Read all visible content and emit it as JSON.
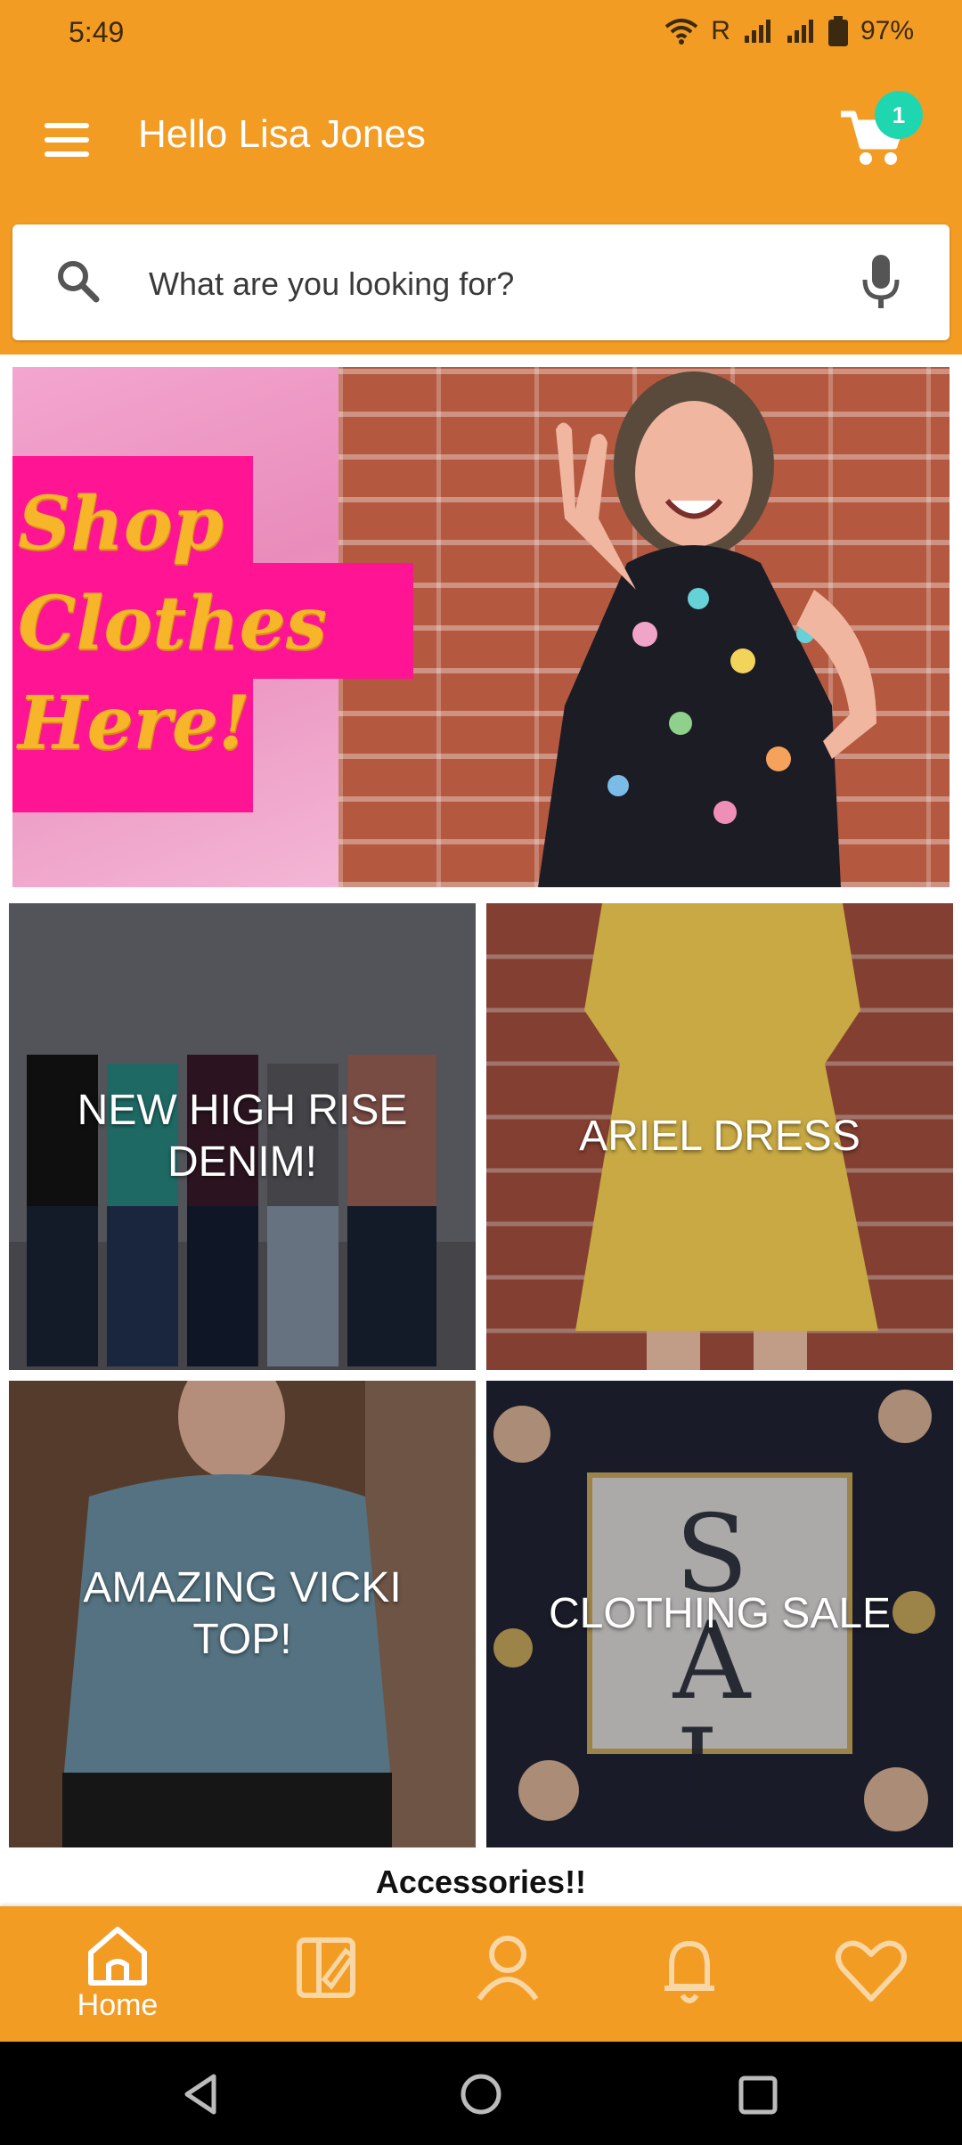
{
  "status_bar": {
    "time": "5:49",
    "network_label": "R",
    "battery": "97%"
  },
  "header": {
    "greeting": "Hello Lisa Jones",
    "cart_count": "1"
  },
  "search": {
    "placeholder": "What are you looking for?"
  },
  "hero": {
    "text": "Shop\nClothes\nHere!"
  },
  "tiles": [
    {
      "title": "NEW HIGH RISE DENIM!"
    },
    {
      "title": "ARIEL DRESS"
    },
    {
      "title": "AMAZING VICKI TOP!"
    },
    {
      "title": "CLOTHING SALE"
    }
  ],
  "sale_sign": {
    "letters": "SALE"
  },
  "section": {
    "title": "Accessories!!"
  },
  "bottom_nav": {
    "items": [
      {
        "label": "Home",
        "icon": "home-icon",
        "active": true
      },
      {
        "label": "",
        "icon": "catalog-icon"
      },
      {
        "label": "",
        "icon": "profile-icon"
      },
      {
        "label": "",
        "icon": "bell-icon"
      },
      {
        "label": "",
        "icon": "heart-icon"
      }
    ]
  },
  "colors": {
    "brand": "#F39C24",
    "badge": "#1ed6b0"
  }
}
